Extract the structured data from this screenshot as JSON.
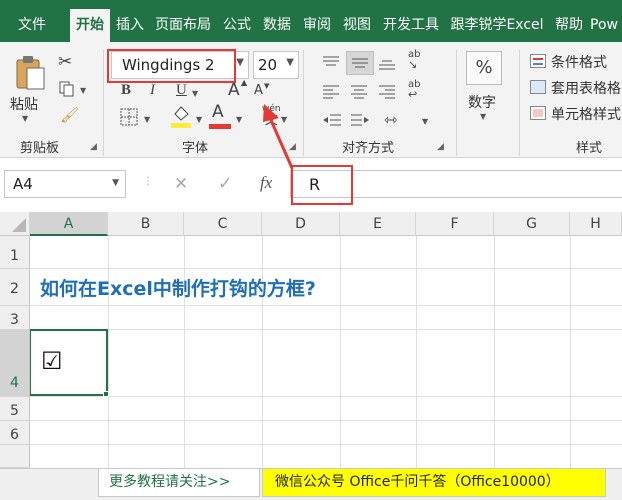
{
  "ribbon_tabs": [
    "文件",
    "开始",
    "插入",
    "页面布局",
    "公式",
    "数据",
    "审阅",
    "视图",
    "开发工具",
    "跟李锐学Excel",
    "帮助",
    "Pow"
  ],
  "clipboard": {
    "paste_label": "粘贴",
    "group_label": "剪贴板"
  },
  "font": {
    "font_name": "Wingdings 2",
    "font_size": "20",
    "group_label": "字体",
    "bold": "B",
    "italic": "I",
    "underline": "U",
    "grow": "A",
    "shrink": "A",
    "font_color_glyph": "A",
    "phonetic_top": "wén",
    "phonetic_bottom": "文",
    "fill_color": "#ffeb3b",
    "font_color": "#e53935"
  },
  "alignment": {
    "group_label": "对齐方式",
    "wrap_glyph": "ab",
    "orient_glyph": "ab"
  },
  "number": {
    "percent": "%",
    "label": "数字"
  },
  "styles": {
    "group_label": "样式",
    "items": [
      "条件格式",
      "套用表格格",
      "单元格样式"
    ]
  },
  "formula_bar": {
    "name_box": "A4",
    "cancel": "✕",
    "enter": "✓",
    "fx": "fx",
    "formula": "R"
  },
  "columns": [
    "A",
    "B",
    "C",
    "D",
    "E",
    "F",
    "G",
    "H"
  ],
  "rows": [
    "1",
    "2",
    "3",
    "4",
    "5",
    "6"
  ],
  "cells": {
    "a2": "如何在Excel中制作打钩的方框?",
    "a4": "☑"
  },
  "sheet_tabs": [
    "更多教程请关注>>",
    "微信公众号 Office千问千答（Office10000）"
  ],
  "colors": {
    "brand": "#217346",
    "highlight": "#e53935",
    "title_blue": "#1f6fb8",
    "tab_yellow": "#ffff00"
  }
}
